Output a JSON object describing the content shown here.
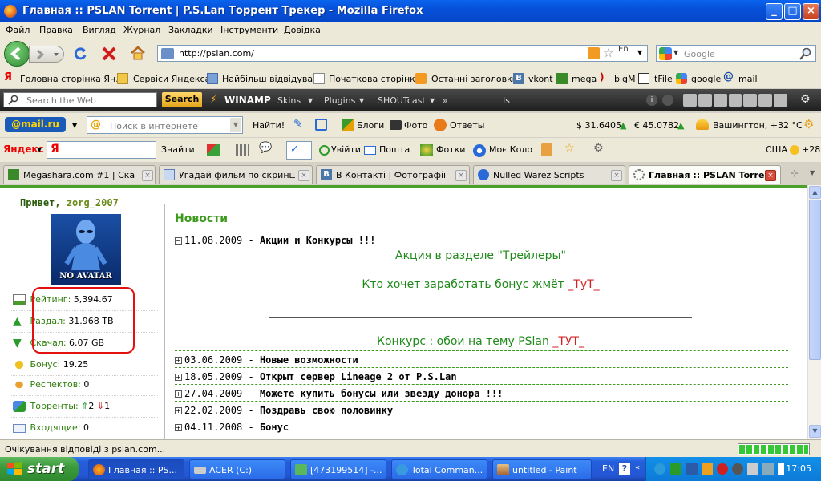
{
  "window": {
    "title": "Главная :: PSLAN Torrent | P.S.Lan Торрент Трекер - Mozilla Firefox",
    "controls": {
      "minimize": "_",
      "maximize": "□",
      "close": "×"
    }
  },
  "menu": [
    "Файл",
    "Правка",
    "Вигляд",
    "Журнал",
    "Закладки",
    "Інструменти",
    "Довідка"
  ],
  "nav": {
    "url": "http://pslan.com/",
    "search_placeholder": "Google",
    "lang_badge": "En"
  },
  "bookmarks": [
    "Головна сторінка Ян...",
    "Сервіси Яндекса",
    "Найбільш відвідувані",
    "Початкова сторінка",
    "Останні заголовки",
    "vkont",
    "mega",
    "bigM",
    "tFile",
    "google",
    "mail"
  ],
  "winamp": {
    "search_placeholder": "Search the Web",
    "search_button": "Search",
    "brand": "WINAMP",
    "items": [
      "Skins",
      "Plugins",
      "SHOUTcast"
    ],
    "track": "Is"
  },
  "mailru": {
    "brand": "@mail.ru",
    "search_placeholder": "Поиск в интернете",
    "find": "Найти!",
    "blogs": "Блоги",
    "photo": "Фото",
    "answers": "Ответы",
    "usd": "$ 31.6405",
    "eur": "€ 45.0782",
    "weather": "Вашингтон, +32 °C"
  },
  "yandex": {
    "brand": "Яндекс",
    "find": "Знайти",
    "login": "Увійти",
    "mail": "Пошта",
    "photos": "Фотки",
    "circle": "Моє Коло",
    "weather_loc": "США",
    "weather_temp": "+28"
  },
  "tabs": [
    {
      "title": "Megashara.com #1 | Скач...",
      "active": false
    },
    {
      "title": "Угадай фильм по скриншо...",
      "active": false
    },
    {
      "title": "В Контакті | Фотографії",
      "active": false
    },
    {
      "title": "Nulled Warez Scripts",
      "active": false
    },
    {
      "title": "Главная :: PSLAN Torre...",
      "active": true
    }
  ],
  "sidebar": {
    "greeting": "Привет,",
    "username": "zorg_2007",
    "avatar_text": "NO AVATAR",
    "rating_label": "Рейтинг:",
    "rating": "5,394.67",
    "upload_label": "Раздал:",
    "upload": "31.968 TB",
    "download_label": "Скачал:",
    "download": "6.07 GB",
    "bonus_label": "Бонус:",
    "bonus": "19.25",
    "respect_label": "Респектов:",
    "respect": "0",
    "torrents_label": "Торренты:",
    "seeding": "2",
    "leeching": "1",
    "inbox_label": "Входящие:",
    "inbox": "0"
  },
  "news": {
    "header": "Новости",
    "open_item": {
      "date": "11.08.2009",
      "title": "Акции и Конкурсы !!!"
    },
    "promo1": "Акция в разделе \"Трейлеры\"",
    "promo2_text": "Кто хочет заработать бонус жмёт ",
    "promo2_link": "_ТуТ_",
    "contest_text": "Конкурс : обои на тему PSlan ",
    "contest_link": "_ТУТ_",
    "items": [
      {
        "date": "03.06.2009",
        "title": "Новые возможности"
      },
      {
        "date": "18.05.2009",
        "title": "Открыт сервер Lineage 2 от P.S.Lan"
      },
      {
        "date": "27.04.2009",
        "title": "Можете купить бонусы или звезду донора !!!"
      },
      {
        "date": "22.02.2009",
        "title": "Поздравь свою половинку"
      },
      {
        "date": "04.11.2008",
        "title": "Бонус"
      }
    ]
  },
  "status": {
    "text": "Очікування відповіді з pslan.com..."
  },
  "taskbar": {
    "start": "start",
    "buttons": [
      "Главная :: PS...",
      "ACER (C:)",
      "[473199514] -...",
      "Total Comman...",
      "untitled - Paint"
    ],
    "lang": "EN",
    "clock": "17:05"
  },
  "colors": {
    "accent_green": "#2e7d0a",
    "news_green": "#3c9a1a",
    "highlight_red": "#e31010",
    "link_red": "#d42020"
  }
}
